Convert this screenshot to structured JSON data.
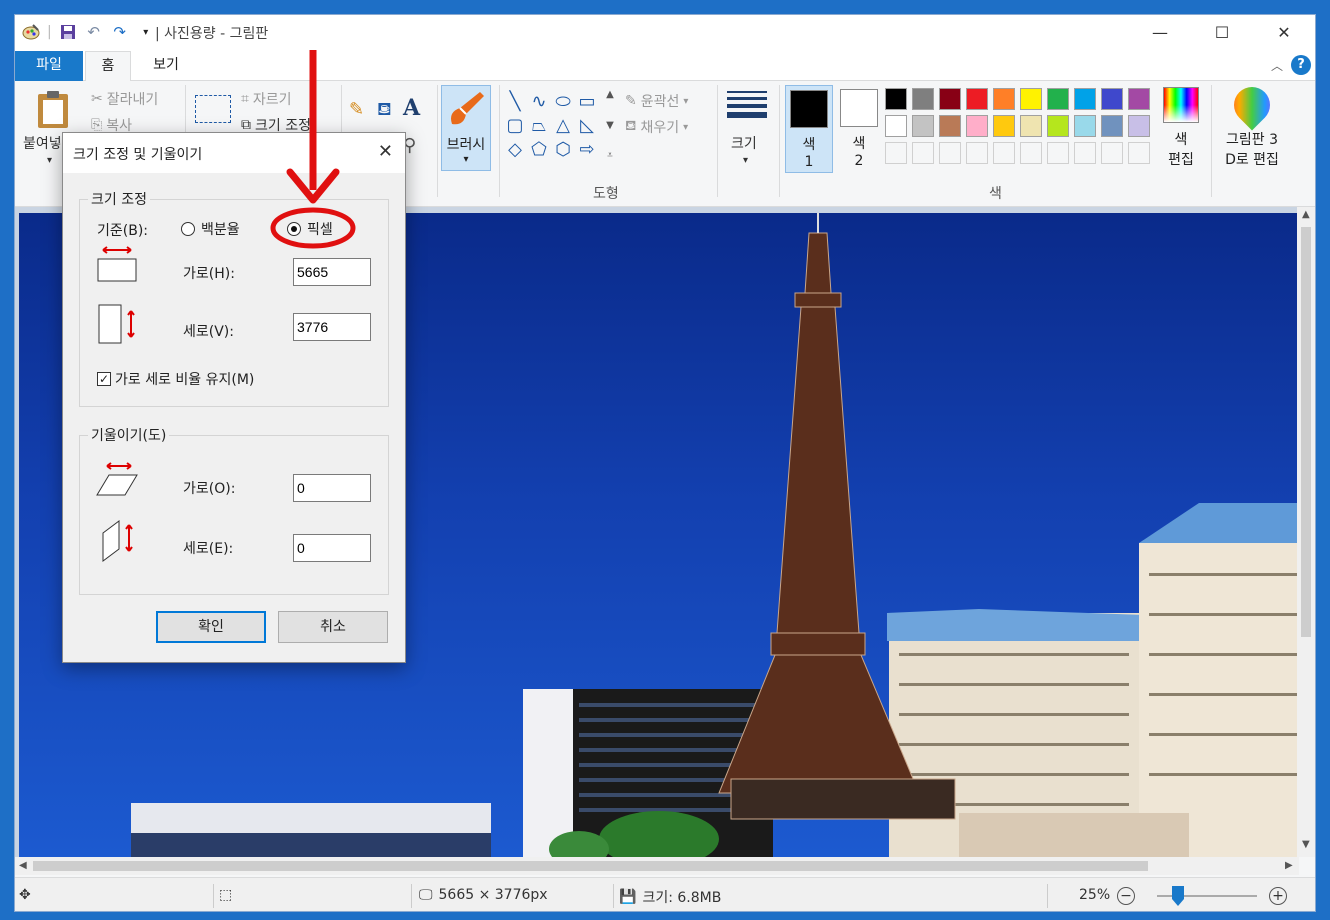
{
  "window": {
    "title": "| 사진용량 - 그림판",
    "controls": {
      "minimize": "—",
      "maximize": "☐",
      "close": "✕"
    }
  },
  "tabs": {
    "file": "파일",
    "home": "홈",
    "view": "보기"
  },
  "ribbon": {
    "clipboard": {
      "paste": "붙여넣",
      "cut": "잘라내기",
      "copy": "복사"
    },
    "image": {
      "crop": "자르기",
      "resize": "크기 조정"
    },
    "brush": "브러시",
    "outline": "윤곽선",
    "fill": "채우기",
    "shapes_group": "도형",
    "size": "크기",
    "color1": {
      "label": "색",
      "num": "1"
    },
    "color2": {
      "label": "색",
      "num": "2"
    },
    "edit_colors": {
      "line1": "색",
      "line2": "편집"
    },
    "edit_3d": {
      "line1": "그림판 3",
      "line2": "D로 편집"
    },
    "colors_group": "색",
    "palette": [
      "#000000",
      "#7f7f7f",
      "#880015",
      "#ed1c24",
      "#ff7f27",
      "#fff200",
      "#22b14c",
      "#00a2e8",
      "#3f48cc",
      "#a349a4",
      "#ffffff",
      "#c3c3c3",
      "#b97a57",
      "#ffaec9",
      "#ffc90e",
      "#efe4b0",
      "#b5e61d",
      "#99d9ea",
      "#7092be",
      "#c8bfe7",
      "",
      "",
      "",
      "",
      "",
      "",
      "",
      "",
      "",
      ""
    ]
  },
  "dialog": {
    "title": "크기 조정 및 기울이기",
    "resize_legend": "크기 조정",
    "basis_label": "기준(B):",
    "opt_percent": "백분율",
    "opt_pixel": "픽셀",
    "horizontal_label": "가로(H):",
    "horizontal_value": "5665",
    "vertical_label": "세로(V):",
    "vertical_value": "3776",
    "keep_ratio": "가로 세로 비율 유지(M)",
    "skew_legend": "기울이기(도)",
    "skew_h_label": "가로(O):",
    "skew_h_value": "0",
    "skew_v_label": "세로(E):",
    "skew_v_value": "0",
    "ok": "확인",
    "cancel": "취소"
  },
  "status": {
    "dimensions": "5665 × 3776px",
    "filesize": "크기: 6.8MB",
    "zoom": "25%",
    "zoom_level": 0.05
  },
  "colors": {
    "accent": "#1979ca",
    "annotation": "#e01010",
    "sky": "#1340b0"
  }
}
